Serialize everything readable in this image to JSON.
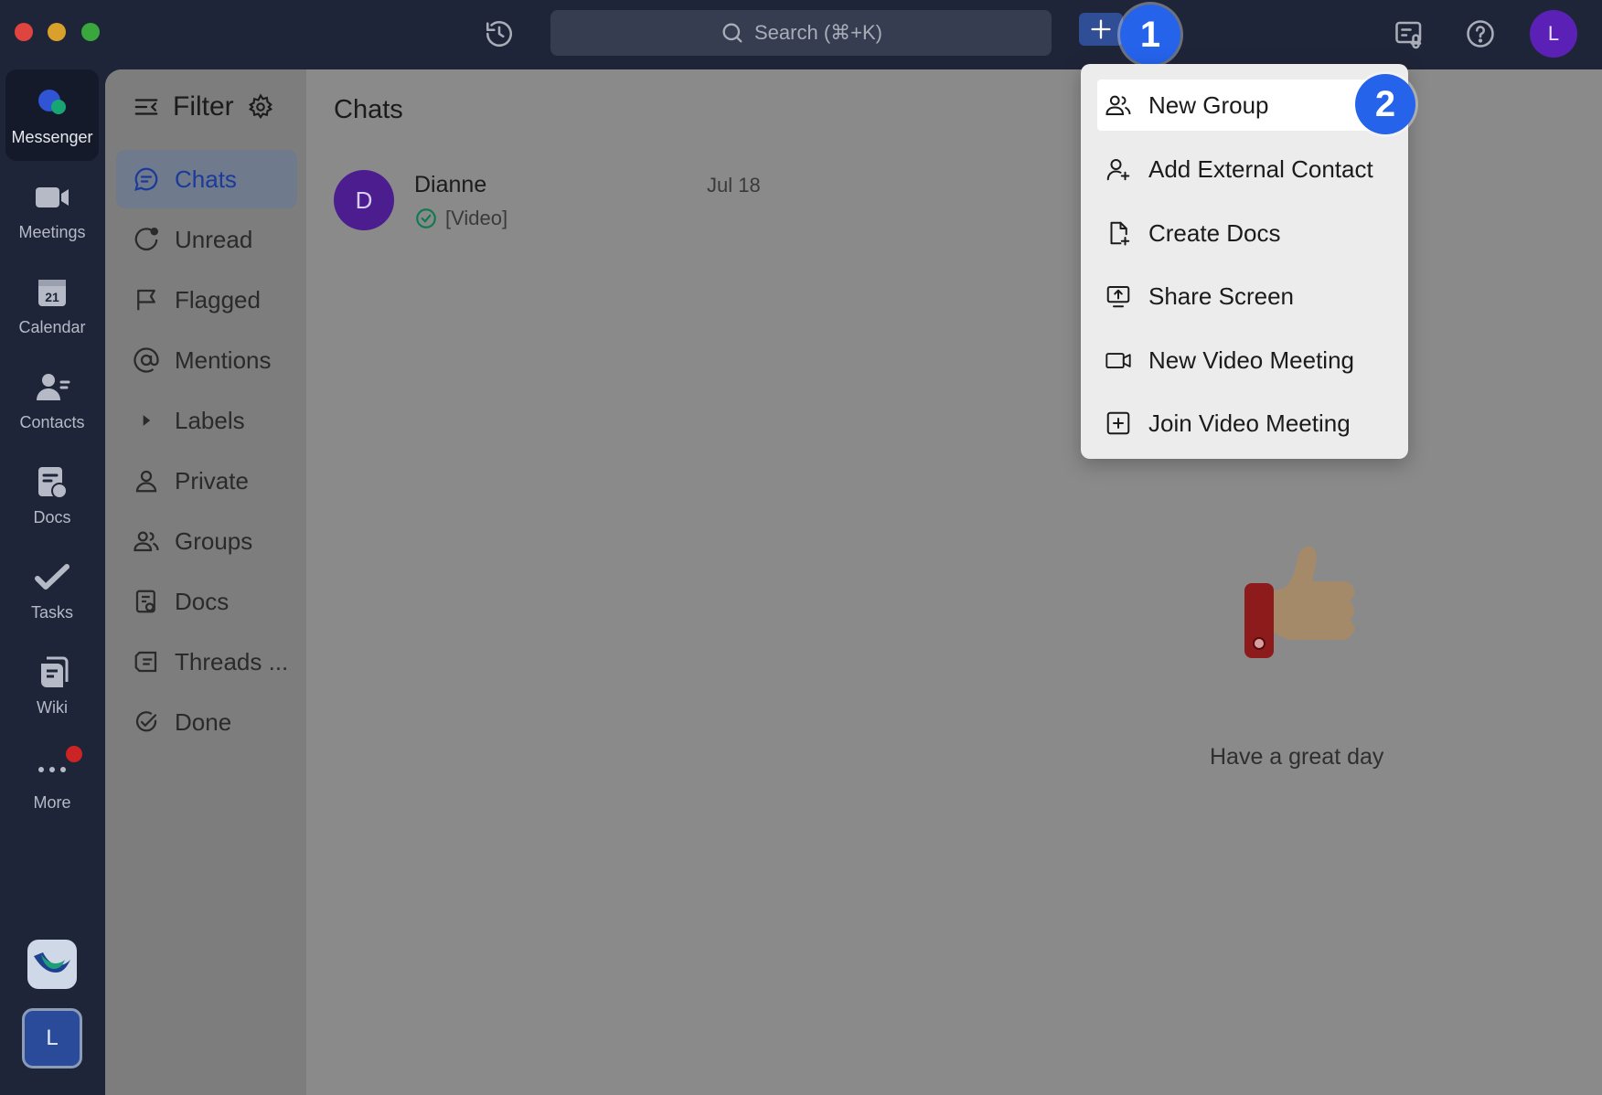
{
  "titlebar": {
    "search_placeholder": "Search (⌘+K)",
    "user_initial": "L"
  },
  "annotations": {
    "step1": "1",
    "step2": "2"
  },
  "leftnav": {
    "items": [
      {
        "label": "Messenger",
        "icon": "messenger-icon",
        "active": true
      },
      {
        "label": "Meetings",
        "icon": "video-camera-icon"
      },
      {
        "label": "Calendar",
        "icon": "calendar-icon",
        "calendar_day": "21"
      },
      {
        "label": "Contacts",
        "icon": "contacts-icon"
      },
      {
        "label": "Docs",
        "icon": "docs-icon"
      },
      {
        "label": "Tasks",
        "icon": "tasks-icon"
      },
      {
        "label": "Wiki",
        "icon": "wiki-icon"
      },
      {
        "label": "More",
        "icon": "more-icon"
      }
    ],
    "bottom_user_initial": "L"
  },
  "filter": {
    "title": "Filter",
    "items": [
      {
        "label": "Chats",
        "icon": "chat-bubble-icon",
        "active": true
      },
      {
        "label": "Unread",
        "icon": "unread-icon"
      },
      {
        "label": "Flagged",
        "icon": "flag-icon"
      },
      {
        "label": "Mentions",
        "icon": "at-sign-icon"
      },
      {
        "label": "Labels",
        "icon": "caret-right-icon"
      },
      {
        "label": "Private",
        "icon": "person-icon"
      },
      {
        "label": "Groups",
        "icon": "group-icon"
      },
      {
        "label": "Docs",
        "icon": "doc-icon"
      },
      {
        "label": "Threads ...",
        "icon": "threads-icon"
      },
      {
        "label": "Done",
        "icon": "done-check-icon"
      }
    ]
  },
  "chats": {
    "title": "Chats",
    "list": [
      {
        "initial": "D",
        "name": "Dianne",
        "date": "Jul 18",
        "preview": "[Video]"
      }
    ]
  },
  "empty_state": {
    "message": "Have a great day"
  },
  "menu": {
    "items": [
      {
        "label": "New Group",
        "icon": "group-add-icon",
        "active": true
      },
      {
        "label": "Add External Contact",
        "icon": "add-contact-icon"
      },
      {
        "label": "Create Docs",
        "icon": "create-doc-icon"
      },
      {
        "label": "Share Screen",
        "icon": "share-screen-icon"
      },
      {
        "label": "New Video Meeting",
        "icon": "video-meeting-icon"
      },
      {
        "label": "Join Video Meeting",
        "icon": "join-meeting-icon"
      }
    ]
  },
  "colors": {
    "sidebar_bg": "#1f2538",
    "accent_blue": "#2563eb",
    "active_label": "#1b3a9a",
    "avatar_purple": "#5b21b6"
  }
}
